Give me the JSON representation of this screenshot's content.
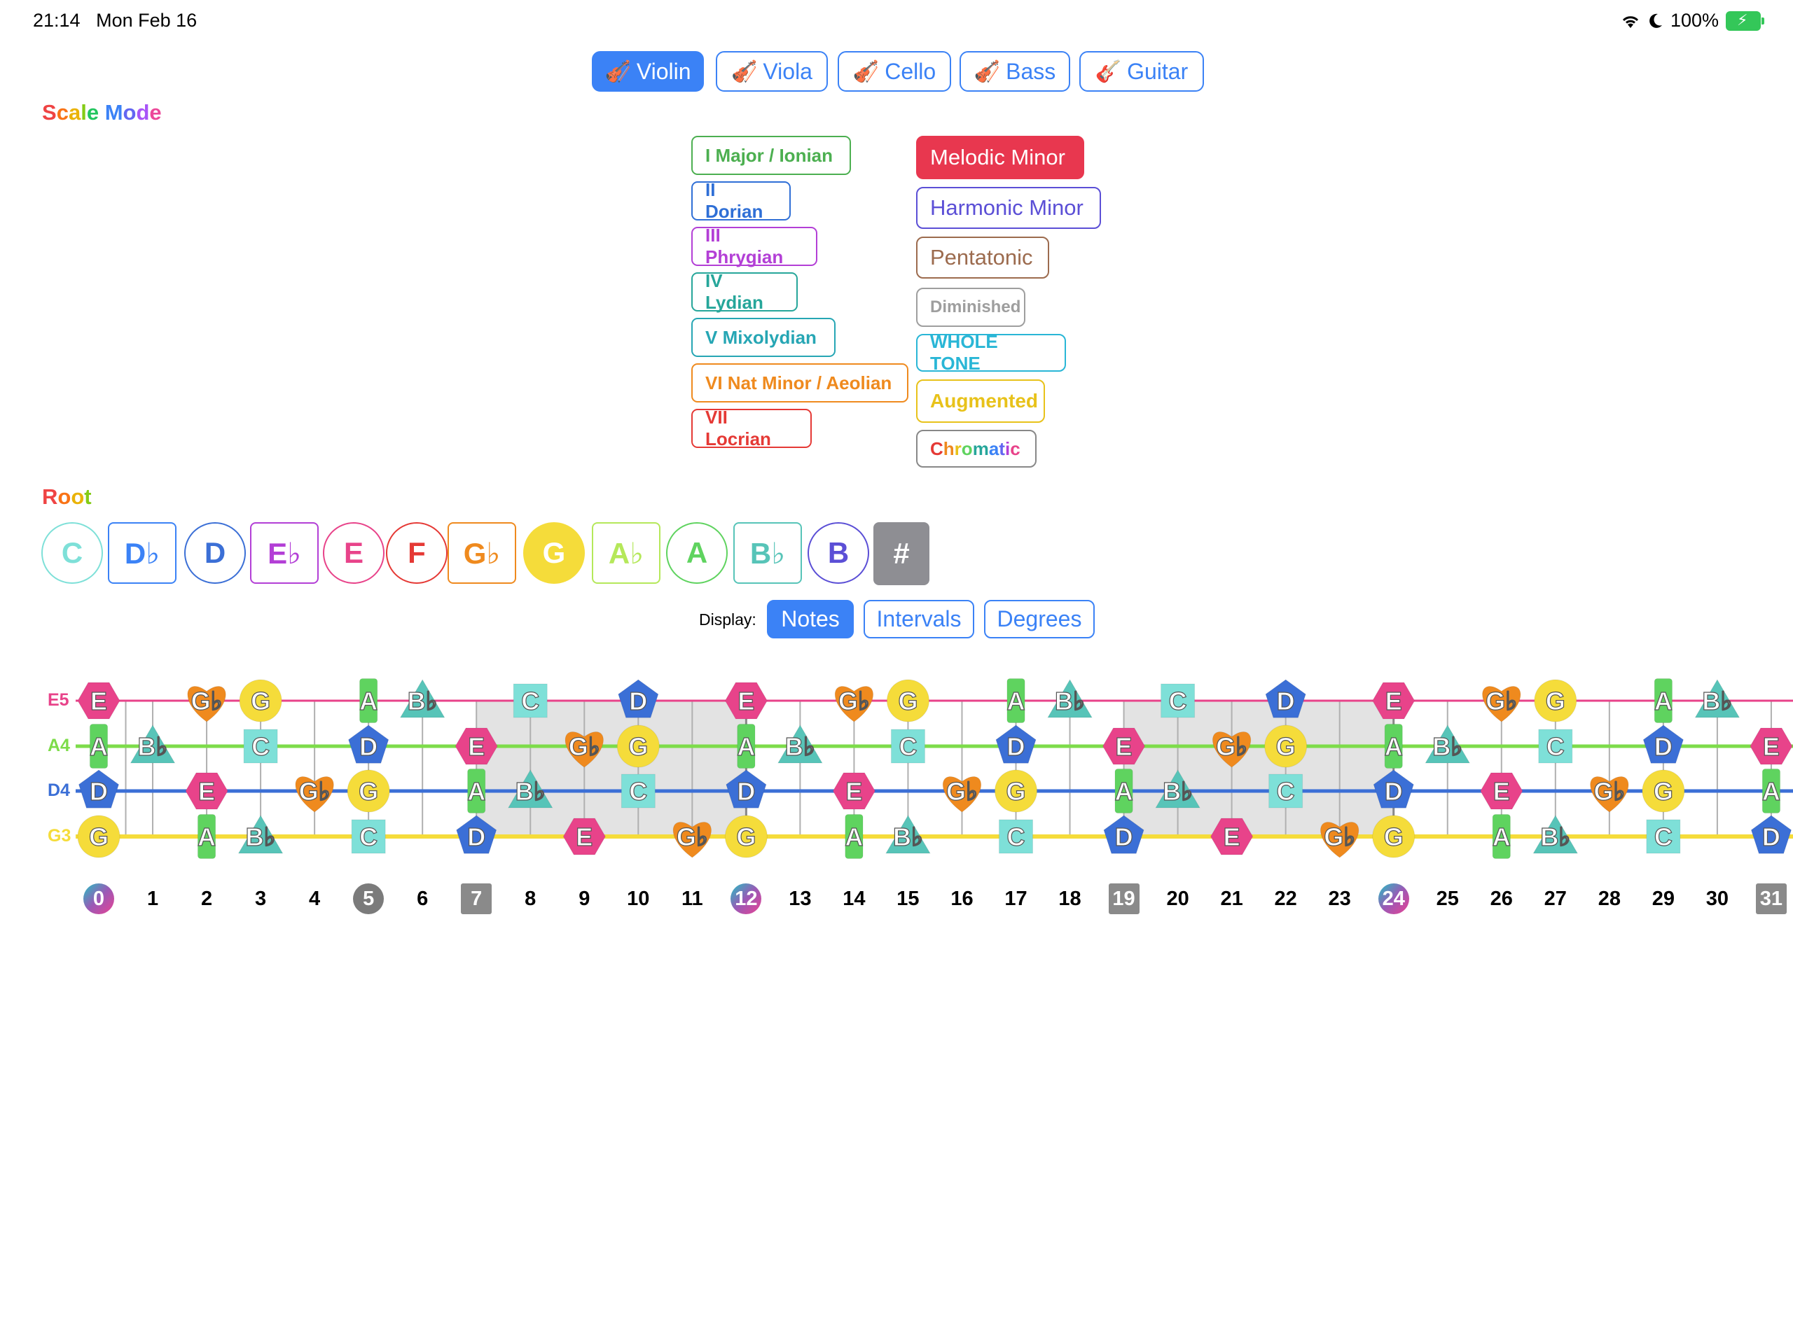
{
  "status_bar": {
    "time": "21:14",
    "date": "Mon Feb 16",
    "battery": "100%"
  },
  "instruments": [
    {
      "label": "Violin",
      "icon": "violin-icon",
      "active": true
    },
    {
      "label": "Viola",
      "icon": "violin-icon",
      "active": false
    },
    {
      "label": "Cello",
      "icon": "violin-icon",
      "active": false
    },
    {
      "label": "Bass",
      "icon": "violin-icon",
      "active": false
    },
    {
      "label": "Guitar",
      "icon": "guitar-icon",
      "active": false
    }
  ],
  "scale_mode_label": "Scale Mode",
  "modes_left": [
    {
      "label": "I  Major / Ionian",
      "color": "#4caf50"
    },
    {
      "label": "II Dorian",
      "color": "#2f6fd6"
    },
    {
      "label": "III Phrygian",
      "color": "#b33fd6"
    },
    {
      "label": "IV Lydian",
      "color": "#26a69a"
    },
    {
      "label": "V  Mixolydian",
      "color": "#26a6b4"
    },
    {
      "label": "VI Nat Minor / Aeolian",
      "color": "#ef8a1e"
    },
    {
      "label": "VII Locrian",
      "color": "#e53935"
    }
  ],
  "modes_right": [
    {
      "label": "Melodic Minor",
      "color": "#e8374f",
      "active": true
    },
    {
      "label": "Harmonic Minor",
      "color": "#5b4fd6"
    },
    {
      "label": "Pentatonic",
      "color": "#9c6b4e"
    },
    {
      "label": "Diminished",
      "color": "#9e9e9e"
    },
    {
      "label": "WHOLE TONE",
      "color": "#29b6d6"
    },
    {
      "label": "Augmented",
      "color": "#e8c21a"
    },
    {
      "label": "Chromatic",
      "color": "#333333"
    }
  ],
  "root_label": "Root",
  "roots": [
    {
      "label": "C",
      "color": "#7ee0d8",
      "shape": "circle"
    },
    {
      "label": "D♭",
      "color": "#3b82f6",
      "shape": "square"
    },
    {
      "label": "D",
      "color": "#3b6fd6",
      "shape": "circle"
    },
    {
      "label": "E♭",
      "color": "#b33fd6",
      "shape": "square"
    },
    {
      "label": "E",
      "color": "#e8438a",
      "shape": "circle"
    },
    {
      "label": "F",
      "color": "#e53935",
      "shape": "circle"
    },
    {
      "label": "G♭",
      "color": "#ef8a1e",
      "shape": "square"
    },
    {
      "label": "G",
      "color": "#f5dc3a",
      "shape": "circle",
      "active": true
    },
    {
      "label": "A♭",
      "color": "#b5e85a",
      "shape": "square"
    },
    {
      "label": "A",
      "color": "#5fd35f",
      "shape": "circle"
    },
    {
      "label": "B♭",
      "color": "#57c4b8",
      "shape": "square"
    },
    {
      "label": "B",
      "color": "#5b4fd6",
      "shape": "circle"
    },
    {
      "label": "#",
      "color": "#8e8e93",
      "shape": "square",
      "active": true
    }
  ],
  "display_label": "Display:",
  "display_options": [
    {
      "label": "Notes",
      "active": true
    },
    {
      "label": "Intervals",
      "active": false
    },
    {
      "label": "Degrees",
      "active": false
    }
  ],
  "strings": [
    {
      "label": "E5",
      "color": "#e8438a",
      "notes": [
        "E",
        "",
        "Gb",
        "G",
        "",
        "A",
        "Bb",
        "",
        "C",
        "",
        "D",
        "",
        "E",
        "",
        "Gb",
        "G",
        "",
        "A",
        "Bb",
        "",
        "C",
        "",
        "D",
        "",
        "E",
        "",
        "Gb",
        "G",
        "",
        "A",
        "Bb",
        ""
      ]
    },
    {
      "label": "A4",
      "color": "#7ddc4a",
      "notes": [
        "A",
        "Bb",
        "",
        "C",
        "",
        "D",
        "",
        "E",
        "",
        "Gb",
        "G",
        "",
        "A",
        "Bb",
        "",
        "C",
        "",
        "D",
        "",
        "E",
        "",
        "Gb",
        "G",
        "",
        "A",
        "Bb",
        "",
        "C",
        "",
        "D",
        "",
        "E"
      ]
    },
    {
      "label": "D4",
      "color": "#3b6fd6",
      "notes": [
        "D",
        "",
        "E",
        "",
        "Gb",
        "G",
        "",
        "A",
        "Bb",
        "",
        "C",
        "",
        "D",
        "",
        "E",
        "",
        "Gb",
        "G",
        "",
        "A",
        "Bb",
        "",
        "C",
        "",
        "D",
        "",
        "E",
        "",
        "Gb",
        "G",
        "",
        "A"
      ]
    },
    {
      "label": "G3",
      "color": "#f5dc3a",
      "notes": [
        "G",
        "",
        "A",
        "Bb",
        "",
        "C",
        "",
        "D",
        "",
        "E",
        "",
        "Gb",
        "G",
        "",
        "A",
        "Bb",
        "",
        "C",
        "",
        "D",
        "",
        "E",
        "",
        "Gb",
        "G",
        "",
        "A",
        "Bb",
        "",
        "C",
        "",
        "D"
      ]
    }
  ],
  "frets": [
    "0",
    "1",
    "2",
    "3",
    "4",
    "5",
    "6",
    "7",
    "8",
    "9",
    "10",
    "11",
    "12",
    "13",
    "14",
    "15",
    "16",
    "17",
    "18",
    "19",
    "20",
    "21",
    "22",
    "23",
    "24",
    "25",
    "26",
    "27",
    "28",
    "29",
    "30",
    "31"
  ],
  "note_styles": {
    "E": {
      "color": "#e8438a",
      "shape": "hexagon",
      "label": "E"
    },
    "Gb": {
      "color": "#ef8a1e",
      "shape": "heart",
      "label": "G♭"
    },
    "G": {
      "color": "#f5dc3a",
      "shape": "circle",
      "label": "G"
    },
    "A": {
      "color": "#5fd35f",
      "shape": "bar",
      "label": "A"
    },
    "Bb": {
      "color": "#57c4b8",
      "shape": "triangle",
      "label": "B♭"
    },
    "C": {
      "color": "#7ee0d8",
      "shape": "square",
      "label": "C"
    },
    "D": {
      "color": "#3b6fd6",
      "shape": "pentagon",
      "label": "D"
    }
  }
}
